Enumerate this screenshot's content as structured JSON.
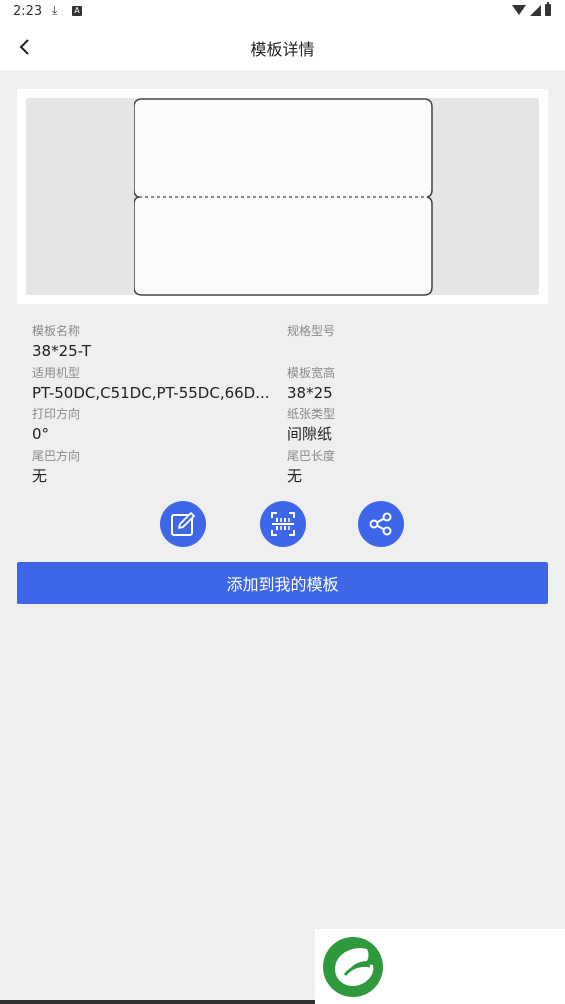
{
  "status_bar": {
    "time": "2:23",
    "download_icon": "download-icon",
    "a_badge": "A"
  },
  "app_bar": {
    "title": "模板详情",
    "back_icon": "chevron-left-icon"
  },
  "info": {
    "template_name_label": "模板名称",
    "template_name_value": "38*25-T",
    "spec_model_label": "规格型号",
    "spec_model_value": "",
    "models_label": "适用机型",
    "models_value": "PT-50DC,C51DC,PT-55DC,66D...",
    "size_label": "模板宽高",
    "size_value": "38*25",
    "print_dir_label": "打印方向",
    "print_dir_value": "0°",
    "paper_type_label": "纸张类型",
    "paper_type_value": "间隙纸",
    "tail_dir_label": "尾巴方向",
    "tail_dir_value": "无",
    "tail_len_label": "尾巴长度",
    "tail_len_value": "无"
  },
  "actions": {
    "edit_icon": "edit-icon",
    "scan_icon": "scan-icon",
    "share_icon": "share-icon"
  },
  "primary_button": {
    "label": "添加到我的模板"
  },
  "colors": {
    "accent": "#3d67e8",
    "page_background": "#efefef",
    "watermark_green": "#2e9a3c"
  }
}
